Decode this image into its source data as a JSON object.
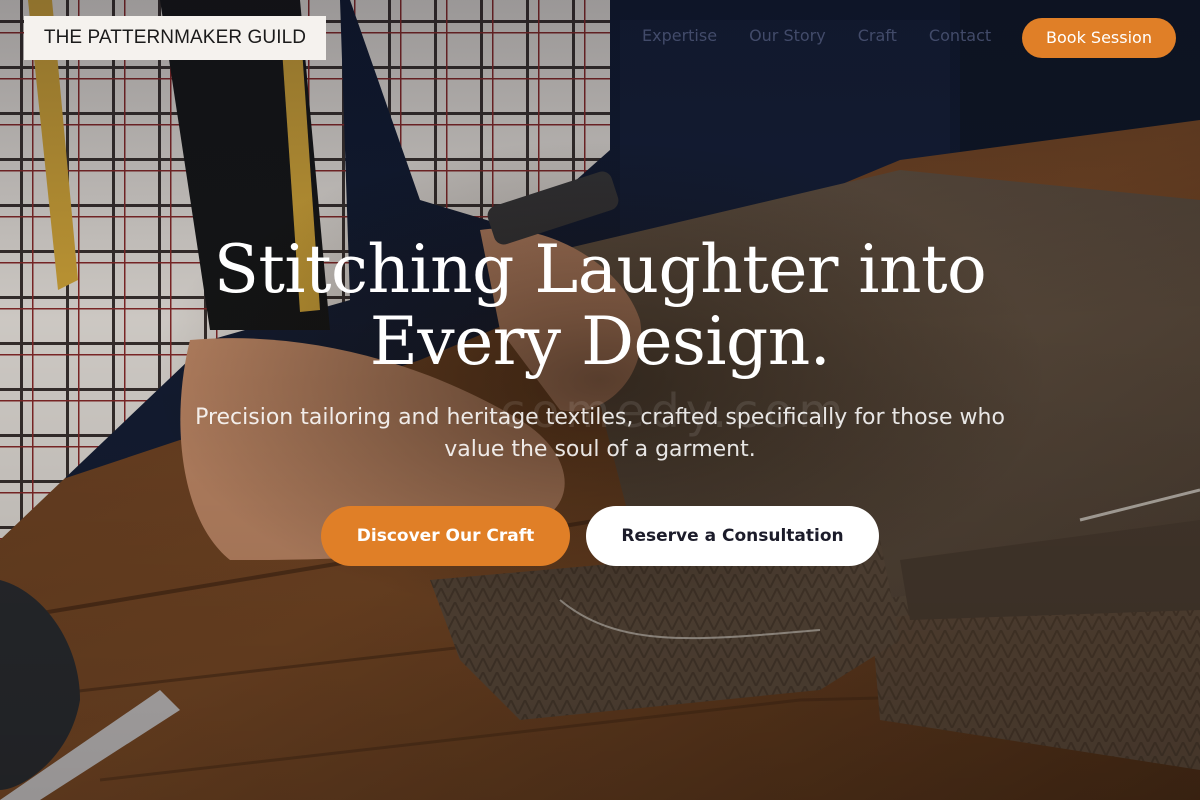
{
  "brand": {
    "name": "THE PATTERNMAKER GUILD"
  },
  "nav": {
    "items": [
      {
        "label": "Expertise"
      },
      {
        "label": "Our Story"
      },
      {
        "label": "Craft"
      },
      {
        "label": "Contact"
      }
    ],
    "cta_label": "Book Session"
  },
  "hero": {
    "title_line1": "Stitching Laughter into",
    "title_line2": "Every Design.",
    "subtitle_line1": "Precision tailoring and heritage textiles, crafted specifically for those who",
    "subtitle_line2": "value the soul of a garment.",
    "watermark": "comedy.com",
    "primary_cta": "Discover Our Craft",
    "secondary_cta": "Reserve a Consultation"
  },
  "colors": {
    "accent": "#e07f27",
    "nav_text": "#464e6e",
    "logo_bg": "#f5f2ee",
    "text_light": "#ffffff"
  },
  "background_image": {
    "subject": "tailor hands cutting tweed fabric on wooden workbench with measuring tape"
  }
}
